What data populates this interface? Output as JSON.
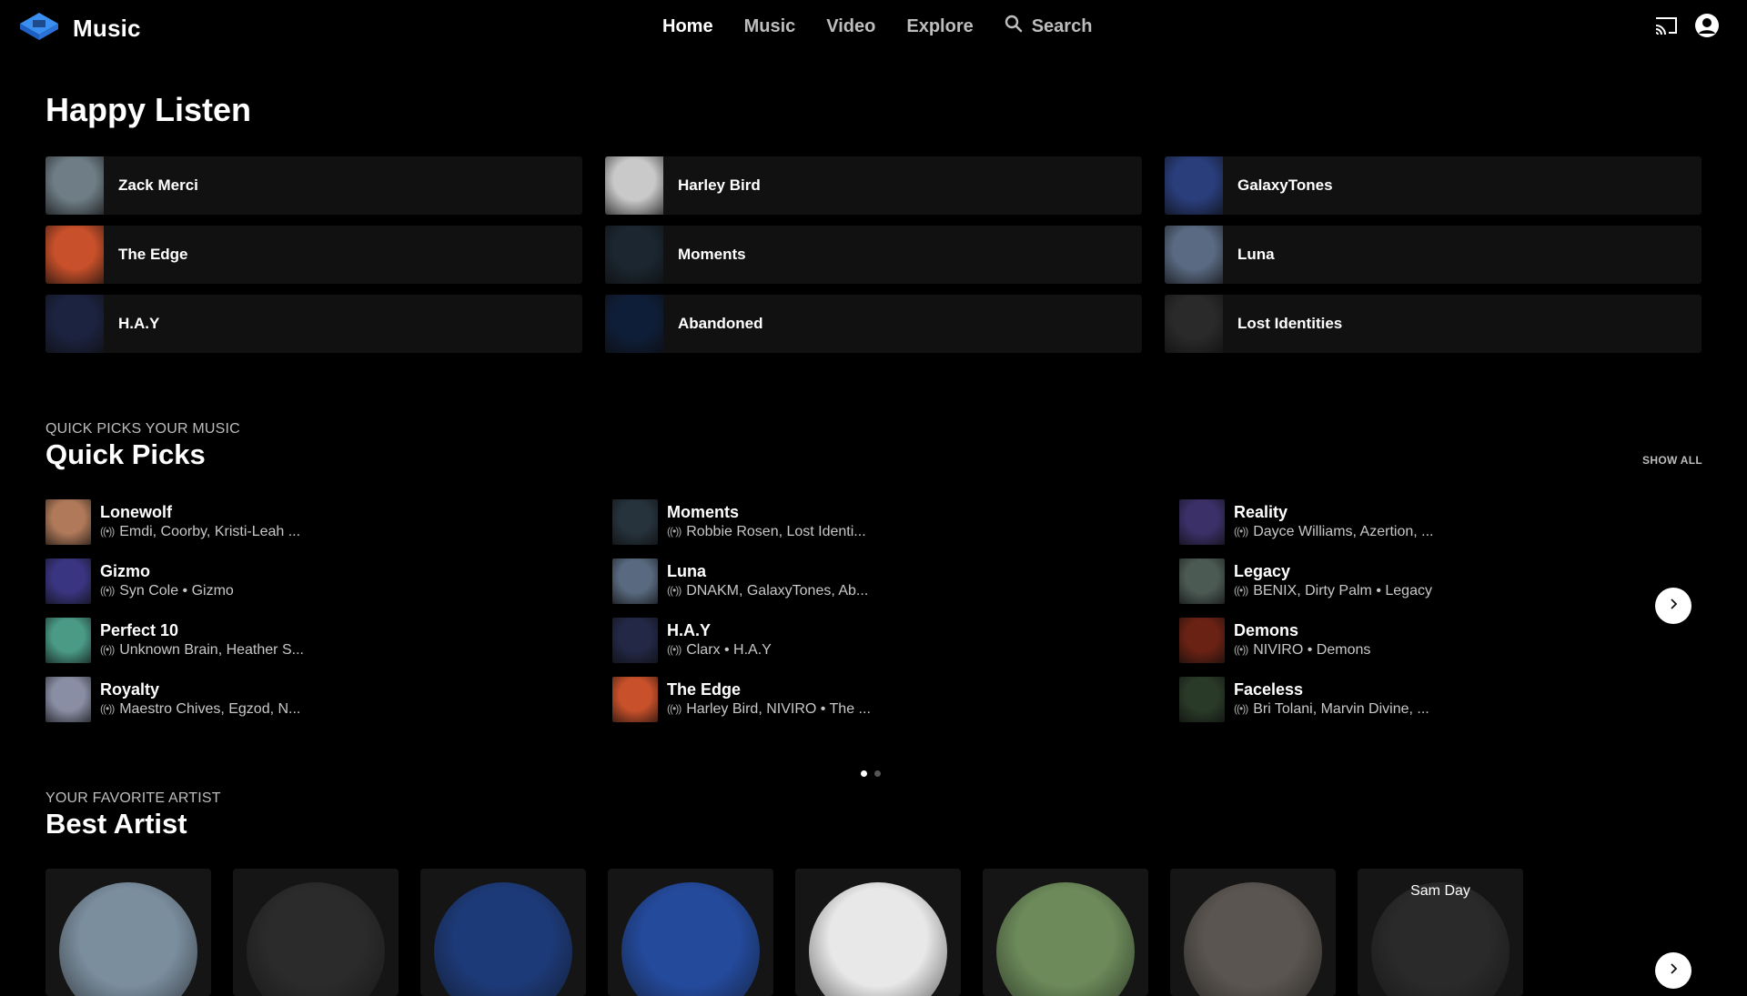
{
  "header": {
    "brand": "Music",
    "nav": [
      {
        "label": "Home",
        "active": true
      },
      {
        "label": "Music",
        "active": false
      },
      {
        "label": "Video",
        "active": false
      },
      {
        "label": "Explore",
        "active": false
      }
    ],
    "search_label": "Search",
    "icons": [
      "logo-icon",
      "search-icon",
      "cast-icon",
      "account-icon"
    ]
  },
  "happy_listen": {
    "title": "Happy Listen",
    "items": [
      {
        "label": "Zack Merci",
        "color": "#6f7e86"
      },
      {
        "label": "Harley Bird",
        "color": "#c9c9c9"
      },
      {
        "label": "GalaxyTones",
        "color": "#2a3e7c"
      },
      {
        "label": "The Edge",
        "color": "#c8502a"
      },
      {
        "label": "Moments",
        "color": "#1b2630"
      },
      {
        "label": "Luna",
        "color": "#5a6a82"
      },
      {
        "label": "H.A.Y",
        "color": "#1c2340"
      },
      {
        "label": "Abandoned",
        "color": "#0f1e38"
      },
      {
        "label": "Lost Identities",
        "color": "#2a2a2a"
      }
    ]
  },
  "quick_picks": {
    "kicker": "QUICK PICKS YOUR MUSIC",
    "title": "Quick Picks",
    "show_all": "SHOW ALL",
    "items": [
      {
        "title": "Lonewolf",
        "subtitle": "Emdi, Coorby, Kristi-Leah ...",
        "color": "#b07a5a"
      },
      {
        "title": "Moments",
        "subtitle": "Robbie Rosen, Lost Identi...",
        "color": "#26323c"
      },
      {
        "title": "Reality",
        "subtitle": "Dayce Williams, Azertion, ...",
        "color": "#3c3068"
      },
      {
        "title": "Gizmo",
        "subtitle": "Syn Cole • Gizmo",
        "color": "#3a3580"
      },
      {
        "title": "Luna",
        "subtitle": "DNAKM, GalaxyTones, Ab...",
        "color": "#596a80"
      },
      {
        "title": "Legacy",
        "subtitle": "BENIX, Dirty Palm • Legacy",
        "color": "#4c5a54"
      },
      {
        "title": "Perfect 10",
        "subtitle": "Unknown Brain, Heather S...",
        "color": "#4a9a86"
      },
      {
        "title": "H.A.Y",
        "subtitle": "Clarx • H.A.Y",
        "color": "#232846"
      },
      {
        "title": "Demons",
        "subtitle": "NIVIRO • Demons",
        "color": "#6a2214"
      },
      {
        "title": "Royalty",
        "subtitle": "Maestro Chives, Egzod, N...",
        "color": "#8a8ea4"
      },
      {
        "title": "The Edge",
        "subtitle": "Harley Bird, NIVIRO • The ...",
        "color": "#c8502a"
      },
      {
        "title": "Faceless",
        "subtitle": "Bri Tolani, Marvin Divine, ...",
        "color": "#2a3a28"
      }
    ]
  },
  "carousel": {
    "pages": 2,
    "current": 1
  },
  "best_artist": {
    "kicker": "YOUR FAVORITE ARTIST",
    "title": "Best Artist",
    "artists": [
      {
        "name": "",
        "color": "#7b8e9e"
      },
      {
        "name": "",
        "color": "#2b2b2b"
      },
      {
        "name": "",
        "color": "#1d3a78"
      },
      {
        "name": "",
        "color": "#244a9c"
      },
      {
        "name": "",
        "color": "#e8e8e8"
      },
      {
        "name": "",
        "color": "#6c8a5a"
      },
      {
        "name": "",
        "color": "#5a5550"
      },
      {
        "name": "Sam Day",
        "color": "#2a2a2a"
      }
    ]
  }
}
